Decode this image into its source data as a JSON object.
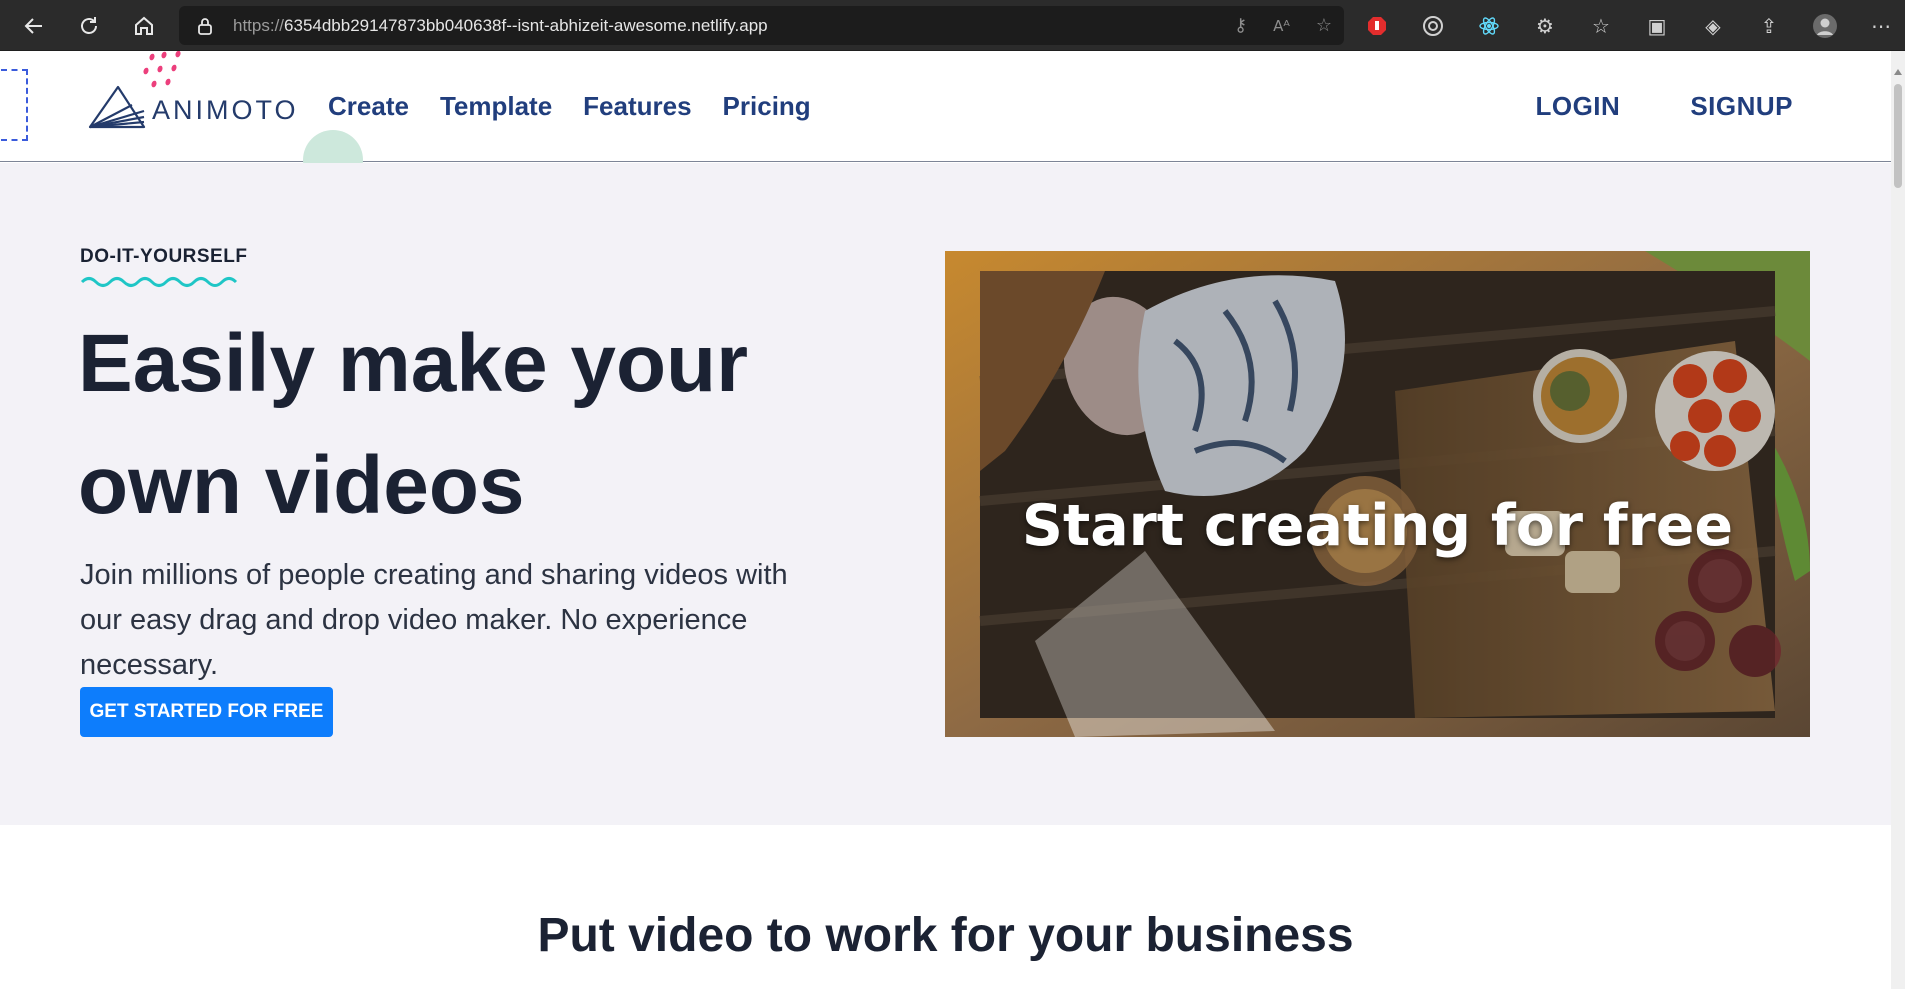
{
  "browser": {
    "url_protocol": "https://",
    "url_host": "6354dbb29147873bb040638f--isnt-abhizeit-awesome.netlify.app",
    "address_icons": [
      "key-icon",
      "read-aloud-icon",
      "add-favorite-icon"
    ],
    "extensions": [
      "adblock-icon",
      "target-icon",
      "react-devtools-icon",
      "puzzle-icon",
      "favorites-icon",
      "collections-icon",
      "performance-icon",
      "share-icon",
      "profile-icon",
      "more-icon"
    ]
  },
  "header": {
    "logo_text": "ANIMOTO",
    "nav": {
      "create": "Create",
      "template": "Template",
      "features": "Features",
      "pricing": "Pricing"
    },
    "login": "LOGIN",
    "signup": "SIGNUP"
  },
  "hero": {
    "eyebrow": "DO-IT-YOURSELF",
    "headline_line1": "Easily make your",
    "headline_line2": "own videos",
    "lede": "Join millions of people creating and sharing videos with our easy drag and drop video maker. No experience necessary.",
    "cta": "GET STARTED FOR FREE",
    "media_caption": "Start creating for free"
  },
  "section": {
    "title": "Put video to work for your business"
  },
  "colors": {
    "nav_text": "#213e7d",
    "cta_bg": "#0d7dfc",
    "hero_bg": "#f3f2f7",
    "wave": "#1fc6c6"
  }
}
